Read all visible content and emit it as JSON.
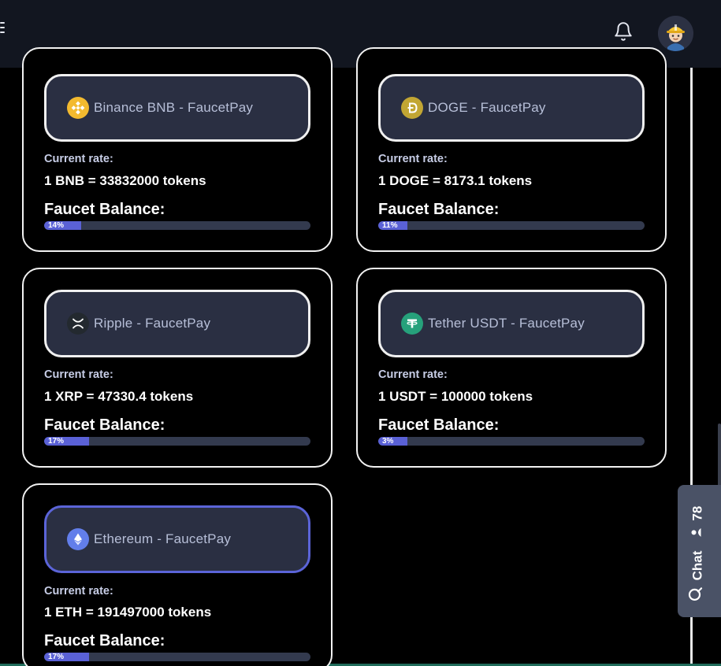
{
  "header": {
    "menu_icon": "menu-icon",
    "bell_icon": "bell-icon",
    "avatar_icon": "avatar-icon"
  },
  "labels": {
    "current_rate": "Current rate:",
    "faucet_balance": "Faucet Balance:"
  },
  "coins": [
    {
      "name": "Binance BNB - FaucetPay",
      "rate": "1 BNB = 33832000 tokens",
      "balance_pct": 14,
      "balance_text": "14%",
      "logo_color": "#F3BA2F",
      "icon": "bnb-icon"
    },
    {
      "name": "DOGE - FaucetPay",
      "rate": "1 DOGE = 8173.1 tokens",
      "balance_pct": 11,
      "balance_text": "11%",
      "logo_color": "#C2A633",
      "icon": "doge-icon"
    },
    {
      "name": "Ripple - FaucetPay",
      "rate": "1 XRP = 47330.4 tokens",
      "balance_pct": 17,
      "balance_text": "17%",
      "logo_color": "#23292F",
      "icon": "xrp-icon"
    },
    {
      "name": "Tether USDT - FaucetPay",
      "rate": "1 USDT = 100000 tokens",
      "balance_pct": 3,
      "balance_text": "3%",
      "logo_color": "#26A17B",
      "icon": "usdt-icon"
    },
    {
      "name": "Ethereum - FaucetPay",
      "rate": "1 ETH = 191497000 tokens",
      "balance_pct": 17,
      "balance_text": "17%",
      "logo_color": "#627EEA",
      "icon": "eth-icon",
      "selected": true
    }
  ],
  "chat": {
    "label": "Chat",
    "count": "78",
    "icon": "chat-icon",
    "user_icon": "user-icon"
  },
  "colors": {
    "accent": "#5a61d6",
    "card_bg": "#2a2f42",
    "topbar": "#121620"
  }
}
